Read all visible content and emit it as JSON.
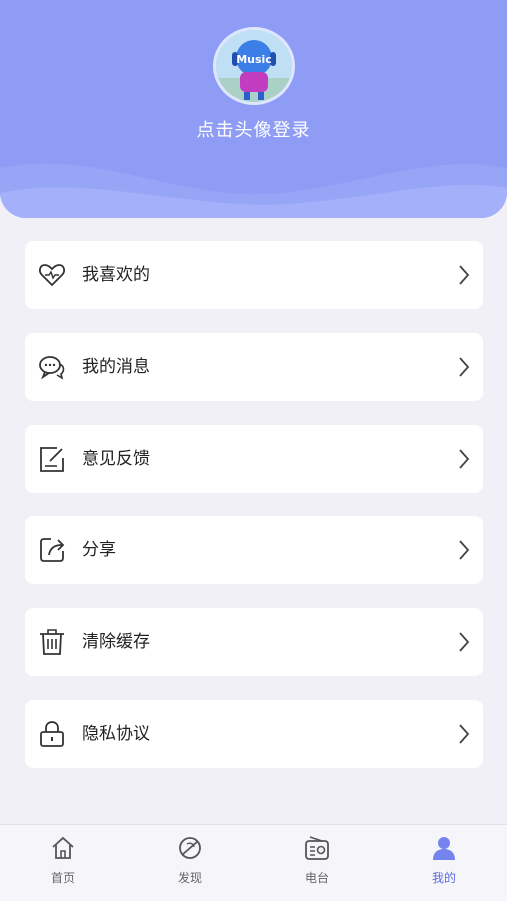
{
  "profile": {
    "login_prompt": "点击头像登录",
    "avatar_text": "Music"
  },
  "menu": [
    {
      "label": "我喜欢的",
      "icon": "heart-icon"
    },
    {
      "label": "我的消息",
      "icon": "chat-icon"
    },
    {
      "label": "意见反馈",
      "icon": "feedback-icon"
    },
    {
      "label": "分享",
      "icon": "share-icon"
    },
    {
      "label": "清除缓存",
      "icon": "trash-icon"
    },
    {
      "label": "隐私协议",
      "icon": "lock-icon"
    }
  ],
  "tabbar": {
    "tabs": [
      {
        "label": "首页",
        "icon": "home-icon"
      },
      {
        "label": "发现",
        "icon": "discover-icon"
      },
      {
        "label": "电台",
        "icon": "radio-icon"
      },
      {
        "label": "我的",
        "icon": "user-icon"
      }
    ],
    "active": "我的"
  },
  "colors": {
    "header": "#8e9cf5",
    "active_tab": "#5b6be0",
    "background": "#f0f0f6"
  }
}
